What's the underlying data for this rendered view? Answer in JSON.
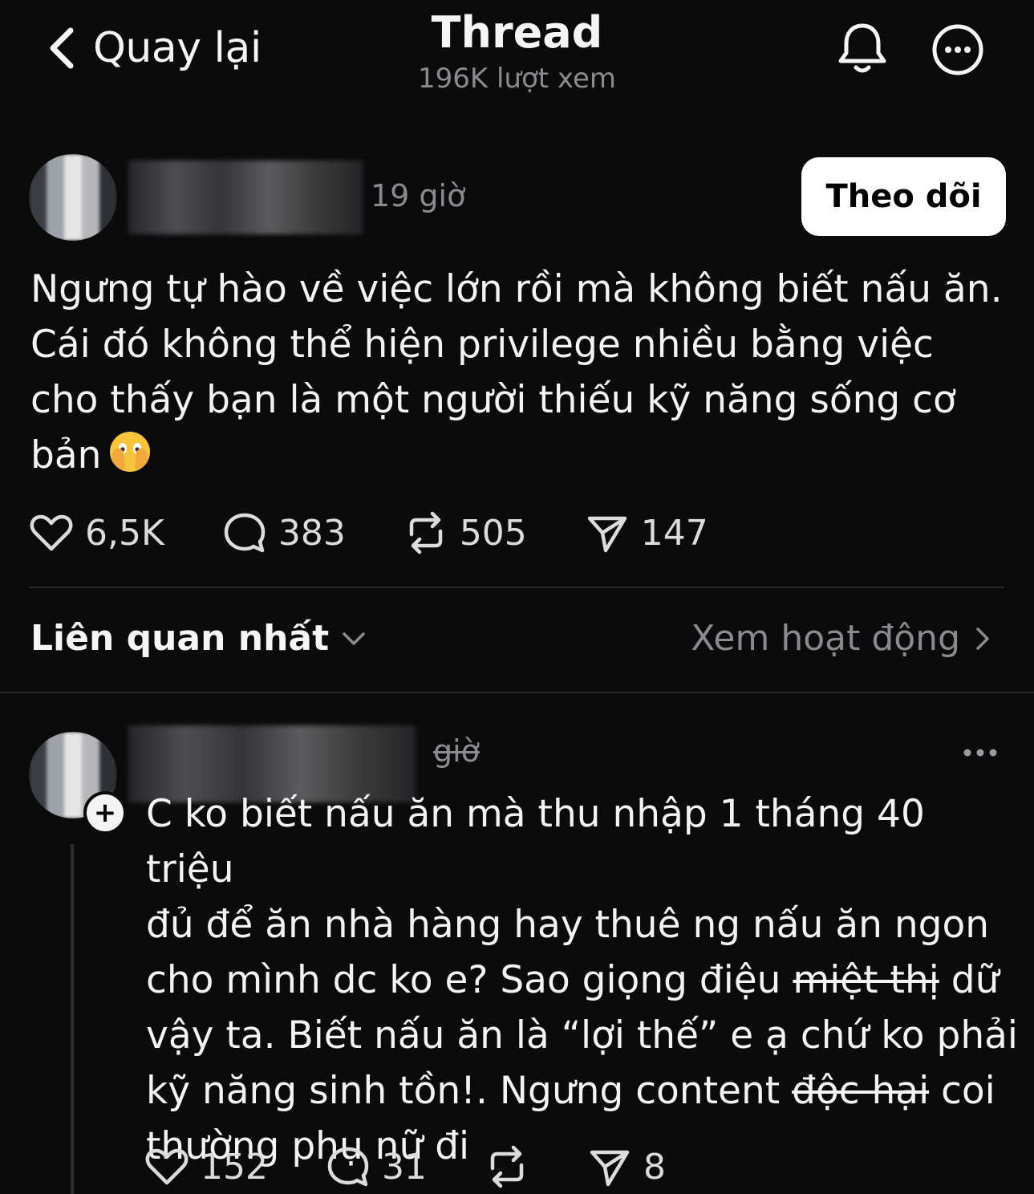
{
  "header": {
    "back_label": "Quay lại",
    "title": "Thread",
    "views": "196K lượt xem",
    "icons": [
      "chevron-left-icon",
      "bell-icon",
      "more-circle-icon"
    ]
  },
  "post": {
    "time": "19 giờ",
    "follow_label": "Theo dõi",
    "text_lines": [
      "Ngưng tự hào về việc lớn rồi mà không biết nấu ăn.",
      "Cái đó không thể hiện privilege nhiều bằng việc",
      "cho thấy bạn là một người thiếu kỹ năng sống cơ",
      "bản"
    ],
    "emoji": "face-with-open-eyes-and-hand-over-mouth",
    "stats": {
      "likes": "6,5K",
      "comments": "383",
      "reposts": "505",
      "shares": "147"
    }
  },
  "sort": {
    "label": "Liên quan nhất",
    "activity_label": "Xem hoạt động"
  },
  "comment": {
    "time": "giờ",
    "line1": "C ko biết nấu ăn mà thu nhập 1 tháng 40 triệu",
    "line2": "đủ để ăn nhà hàng hay thuê ng nấu ăn ngon",
    "line3_pre": "cho mình dc ko e? Sao giọng điệu ",
    "line3_strike": "miệt thị",
    "line3_post": " dữ",
    "line4": "vậy ta. Biết nấu ăn là “lợi thế” e ạ chứ ko phải",
    "line5_pre": "kỹ năng sinh tồn!. Ngưng content ",
    "line5_strike": "độc hại",
    "line5_post": " coi",
    "line6": "thường phụ nữ đi",
    "stats": {
      "likes": "152",
      "comments": "31",
      "shares": "8"
    }
  },
  "colors": {
    "background": "#0b0b0c",
    "muted": "#8a8a8f",
    "follow_bg": "#ffffff"
  }
}
